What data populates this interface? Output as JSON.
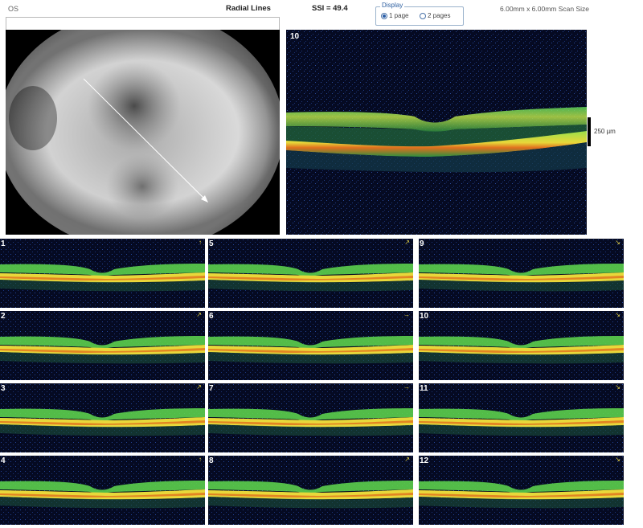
{
  "header": {
    "eye": "OS",
    "scan_type": "Radial Lines",
    "ssi": "SSI = 49.4",
    "scan_size": "6.00mm x 6.00mm Scan Size",
    "display": {
      "legend": "Display",
      "options": [
        {
          "label": "1 page",
          "selected": true
        },
        {
          "label": "2 pages",
          "selected": false
        }
      ]
    }
  },
  "main_scan": {
    "number": "10",
    "scale": "250 µm"
  },
  "thumbnails": [
    {
      "number": "1",
      "dir": "↑"
    },
    {
      "number": "5",
      "dir": "↗"
    },
    {
      "number": "9",
      "dir": "↘"
    },
    {
      "number": "2",
      "dir": "↗"
    },
    {
      "number": "6",
      "dir": "→"
    },
    {
      "number": "10",
      "dir": "↘"
    },
    {
      "number": "3",
      "dir": "↗"
    },
    {
      "number": "7",
      "dir": "→"
    },
    {
      "number": "11",
      "dir": "↘"
    },
    {
      "number": "4",
      "dir": "↑"
    },
    {
      "number": "8",
      "dir": "↗"
    },
    {
      "number": "12",
      "dir": "↘"
    }
  ],
  "colors": {
    "scan_bg": "#050a22",
    "retina_green": "#3fbf3f",
    "rpe_yellow": "#e8d83a",
    "rpe_orange": "#e0701e",
    "accent": "#2a5ea8"
  }
}
